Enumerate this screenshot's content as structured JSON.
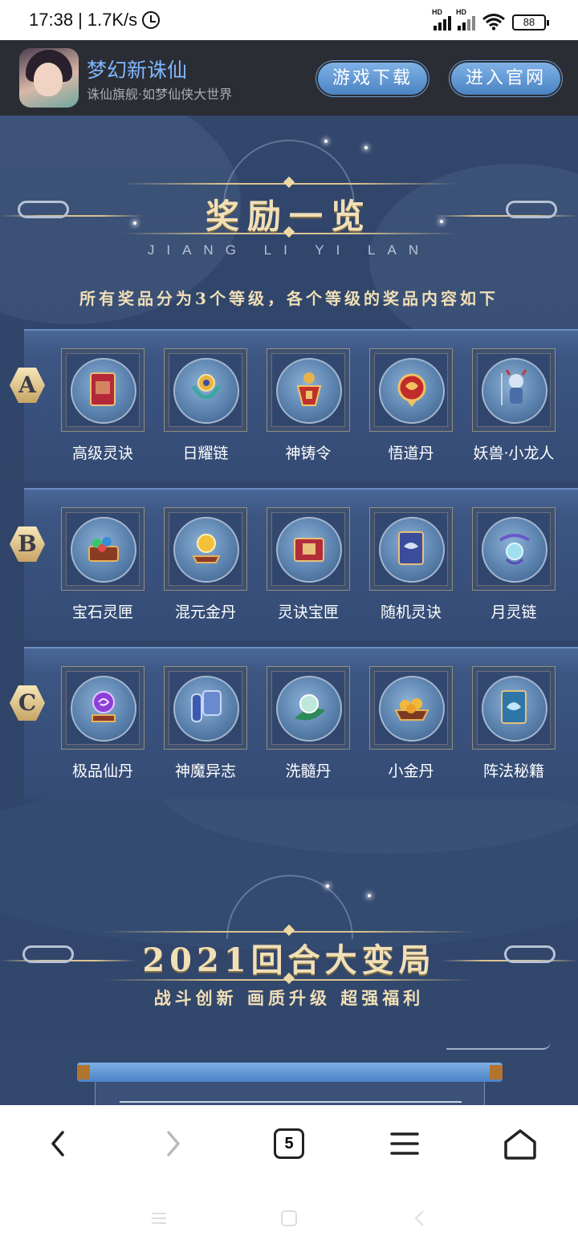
{
  "status_bar": {
    "time": "17:38",
    "speed": "1.7K/s",
    "battery": "88",
    "hd1": "HD",
    "hd2": "HD"
  },
  "header": {
    "app_name": "梦幻新诛仙",
    "subtitle": "诛仙旗舰·如梦仙侠大世界",
    "download_label": "游戏下载",
    "website_label": "进入官网"
  },
  "rewards": {
    "title": "奖励一览",
    "pinyin": "JIANG LI YI LAN",
    "description": "所有奖品分为3个等级，各个等级的奖品内容如下",
    "tiers": [
      {
        "grade": "A",
        "items": [
          {
            "label": "高级灵诀",
            "icon": "red-book-icon"
          },
          {
            "label": "日耀链",
            "icon": "sun-chain-icon"
          },
          {
            "label": "神铸令",
            "icon": "token-icon"
          },
          {
            "label": "悟道丹",
            "icon": "red-pill-icon"
          },
          {
            "label": "妖兽·小龙人",
            "icon": "dragon-figure-icon"
          }
        ]
      },
      {
        "grade": "B",
        "items": [
          {
            "label": "宝石灵匣",
            "icon": "gem-chest-icon"
          },
          {
            "label": "混元金丹",
            "icon": "golden-orb-icon"
          },
          {
            "label": "灵诀宝匣",
            "icon": "red-box-icon"
          },
          {
            "label": "随机灵诀",
            "icon": "blue-book-icon"
          },
          {
            "label": "月灵链",
            "icon": "moon-chain-icon"
          }
        ]
      },
      {
        "grade": "C",
        "items": [
          {
            "label": "极品仙丹",
            "icon": "purple-orb-icon"
          },
          {
            "label": "神魔异志",
            "icon": "scroll-icon"
          },
          {
            "label": "洗髓丹",
            "icon": "jade-pill-icon"
          },
          {
            "label": "小金丹",
            "icon": "gold-pills-icon"
          },
          {
            "label": "阵法秘籍",
            "icon": "teal-book-icon"
          }
        ]
      }
    ]
  },
  "section2": {
    "title": "2021回合大变局",
    "subtitle": "战斗创新 画质升级 超强福利"
  },
  "browser": {
    "tab_count": "5"
  },
  "colors": {
    "page_bg": "#30456a",
    "header_bg": "#2b2d34",
    "gold_text": "#f1dfb6",
    "link_blue": "#7fb7ff"
  }
}
